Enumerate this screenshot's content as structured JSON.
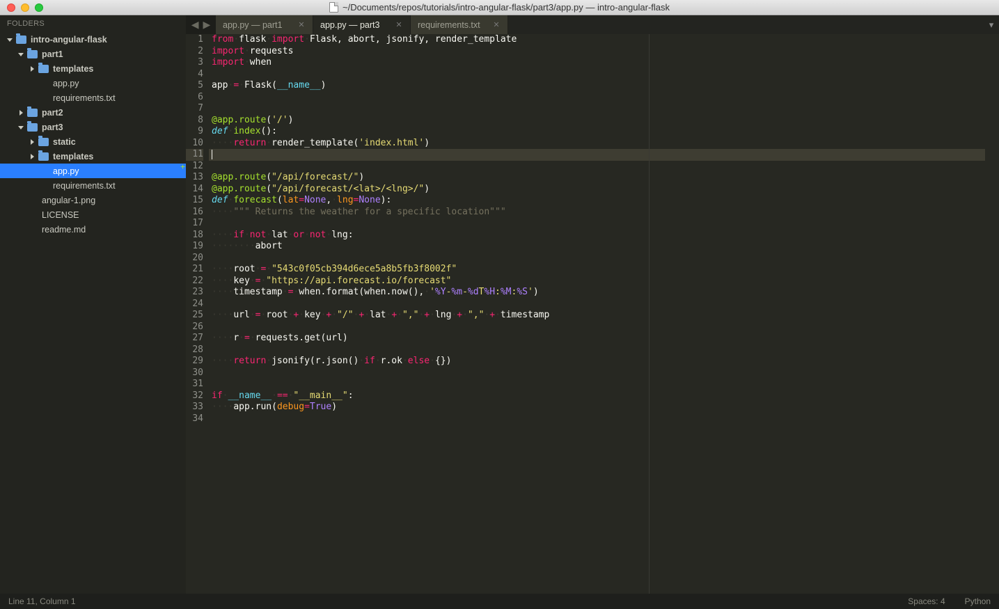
{
  "title": "~/Documents/repos/tutorials/intro-angular-flask/part3/app.py — intro-angular-flask",
  "sidebar": {
    "header": "FOLDERS",
    "nodes": [
      {
        "depth": 0,
        "type": "folder",
        "open": true,
        "label": "intro-angular-flask"
      },
      {
        "depth": 1,
        "type": "folder",
        "open": true,
        "label": "part1"
      },
      {
        "depth": 2,
        "type": "folder",
        "open": false,
        "label": "templates"
      },
      {
        "depth": 2,
        "type": "file",
        "label": "app.py"
      },
      {
        "depth": 2,
        "type": "file",
        "label": "requirements.txt"
      },
      {
        "depth": 1,
        "type": "folder",
        "open": false,
        "label": "part2"
      },
      {
        "depth": 1,
        "type": "folder",
        "open": true,
        "label": "part3"
      },
      {
        "depth": 2,
        "type": "folder",
        "open": false,
        "label": "static"
      },
      {
        "depth": 2,
        "type": "folder",
        "open": false,
        "label": "templates"
      },
      {
        "depth": 2,
        "type": "file",
        "label": "app.py",
        "selected": true
      },
      {
        "depth": 2,
        "type": "file",
        "label": "requirements.txt"
      },
      {
        "depth": 1,
        "type": "file",
        "label": "angular-1.png"
      },
      {
        "depth": 1,
        "type": "file",
        "label": "LICENSE"
      },
      {
        "depth": 1,
        "type": "file",
        "label": "readme.md"
      }
    ]
  },
  "tabs": [
    {
      "label": "app.py — part1",
      "active": false
    },
    {
      "label": "app.py — part3",
      "active": true
    },
    {
      "label": "requirements.txt",
      "active": false
    }
  ],
  "active_line": 11,
  "plus_line": 12,
  "code_lines": [
    [
      {
        "c": "k-red",
        "t": "from"
      },
      {
        "c": "k-dot",
        "t": "·"
      },
      {
        "c": "k-white",
        "t": "flask"
      },
      {
        "c": "k-dot",
        "t": "·"
      },
      {
        "c": "k-red",
        "t": "import"
      },
      {
        "c": "k-dot",
        "t": "·"
      },
      {
        "c": "k-white",
        "t": "Flask, abort, jsonify, render_template"
      }
    ],
    [
      {
        "c": "k-red",
        "t": "import"
      },
      {
        "c": "k-dot",
        "t": "·"
      },
      {
        "c": "k-white",
        "t": "requests"
      }
    ],
    [
      {
        "c": "k-red",
        "t": "import"
      },
      {
        "c": "k-dot",
        "t": "·"
      },
      {
        "c": "k-white",
        "t": "when"
      }
    ],
    [],
    [
      {
        "c": "k-white",
        "t": "app"
      },
      {
        "c": "k-dot",
        "t": "·"
      },
      {
        "c": "k-red",
        "t": "="
      },
      {
        "c": "k-dot",
        "t": "·"
      },
      {
        "c": "k-white",
        "t": "Flask("
      },
      {
        "c": "k-cyan",
        "t": "__name__"
      },
      {
        "c": "k-white",
        "t": ")"
      }
    ],
    [],
    [],
    [
      {
        "c": "k-green",
        "t": "@app.route"
      },
      {
        "c": "k-white",
        "t": "("
      },
      {
        "c": "k-yellow",
        "t": "'/'"
      },
      {
        "c": "k-white",
        "t": ")"
      }
    ],
    [
      {
        "c": "k-def",
        "t": "def"
      },
      {
        "c": "k-dot",
        "t": "·"
      },
      {
        "c": "k-green",
        "t": "index"
      },
      {
        "c": "k-white",
        "t": "():"
      }
    ],
    [
      {
        "c": "k-dot",
        "t": "····"
      },
      {
        "c": "k-red",
        "t": "return"
      },
      {
        "c": "k-dot",
        "t": "·"
      },
      {
        "c": "k-white",
        "t": "render_template("
      },
      {
        "c": "k-yellow",
        "t": "'index.html'"
      },
      {
        "c": "k-white",
        "t": ")"
      }
    ],
    [
      {
        "c": "cursor",
        "t": ""
      }
    ],
    [],
    [
      {
        "c": "k-green",
        "t": "@app.route"
      },
      {
        "c": "k-white",
        "t": "("
      },
      {
        "c": "k-yellow",
        "t": "\"/api/forecast/\""
      },
      {
        "c": "k-white",
        "t": ")"
      }
    ],
    [
      {
        "c": "k-green",
        "t": "@app.route"
      },
      {
        "c": "k-white",
        "t": "("
      },
      {
        "c": "k-yellow",
        "t": "\"/api/forecast/<lat>/<lng>/\""
      },
      {
        "c": "k-white",
        "t": ")"
      }
    ],
    [
      {
        "c": "k-def",
        "t": "def"
      },
      {
        "c": "k-dot",
        "t": "·"
      },
      {
        "c": "k-green",
        "t": "forecast"
      },
      {
        "c": "k-white",
        "t": "("
      },
      {
        "c": "k-orange",
        "t": "lat"
      },
      {
        "c": "k-red",
        "t": "="
      },
      {
        "c": "k-purple",
        "t": "None"
      },
      {
        "c": "k-white",
        "t": ","
      },
      {
        "c": "k-dot",
        "t": "·"
      },
      {
        "c": "k-orange",
        "t": "lng"
      },
      {
        "c": "k-red",
        "t": "="
      },
      {
        "c": "k-purple",
        "t": "None"
      },
      {
        "c": "k-white",
        "t": "):"
      }
    ],
    [
      {
        "c": "k-dot",
        "t": "····"
      },
      {
        "c": "k-comment",
        "t": "\"\"\" Returns the weather for a specific location\"\"\""
      }
    ],
    [],
    [
      {
        "c": "k-dot",
        "t": "····"
      },
      {
        "c": "k-red",
        "t": "if"
      },
      {
        "c": "k-dot",
        "t": "·"
      },
      {
        "c": "k-red",
        "t": "not"
      },
      {
        "c": "k-dot",
        "t": "·"
      },
      {
        "c": "k-white",
        "t": "lat"
      },
      {
        "c": "k-dot",
        "t": "·"
      },
      {
        "c": "k-red",
        "t": "or"
      },
      {
        "c": "k-dot",
        "t": "·"
      },
      {
        "c": "k-red",
        "t": "not"
      },
      {
        "c": "k-dot",
        "t": "·"
      },
      {
        "c": "k-white",
        "t": "lng:"
      }
    ],
    [
      {
        "c": "k-dot",
        "t": "········"
      },
      {
        "c": "k-white",
        "t": "abort"
      }
    ],
    [],
    [
      {
        "c": "k-dot",
        "t": "····"
      },
      {
        "c": "k-white",
        "t": "root"
      },
      {
        "c": "k-dot",
        "t": "·"
      },
      {
        "c": "k-red",
        "t": "="
      },
      {
        "c": "k-dot",
        "t": "·"
      },
      {
        "c": "k-yellow",
        "t": "\"543c0f05cb394d6ece5a8b5fb3f8002f\""
      }
    ],
    [
      {
        "c": "k-dot",
        "t": "····"
      },
      {
        "c": "k-white",
        "t": "key"
      },
      {
        "c": "k-dot",
        "t": "·"
      },
      {
        "c": "k-red",
        "t": "="
      },
      {
        "c": "k-dot",
        "t": "·"
      },
      {
        "c": "k-yellow",
        "t": "\"https://api.forecast.io/forecast\""
      }
    ],
    [
      {
        "c": "k-dot",
        "t": "····"
      },
      {
        "c": "k-white",
        "t": "timestamp"
      },
      {
        "c": "k-dot",
        "t": "·"
      },
      {
        "c": "k-red",
        "t": "="
      },
      {
        "c": "k-dot",
        "t": "·"
      },
      {
        "c": "k-white",
        "t": "when.format(when.now(),"
      },
      {
        "c": "k-dot",
        "t": "·"
      },
      {
        "c": "k-yellow",
        "t": "'"
      },
      {
        "c": "k-purple",
        "t": "%Y"
      },
      {
        "c": "k-yellow",
        "t": "-"
      },
      {
        "c": "k-purple",
        "t": "%m"
      },
      {
        "c": "k-yellow",
        "t": "-"
      },
      {
        "c": "k-purple",
        "t": "%d"
      },
      {
        "c": "k-yellow",
        "t": "T"
      },
      {
        "c": "k-purple",
        "t": "%H"
      },
      {
        "c": "k-yellow",
        "t": ":"
      },
      {
        "c": "k-purple",
        "t": "%M"
      },
      {
        "c": "k-yellow",
        "t": ":"
      },
      {
        "c": "k-purple",
        "t": "%S"
      },
      {
        "c": "k-yellow",
        "t": "'"
      },
      {
        "c": "k-white",
        "t": ")"
      }
    ],
    [],
    [
      {
        "c": "k-dot",
        "t": "····"
      },
      {
        "c": "k-white",
        "t": "url"
      },
      {
        "c": "k-dot",
        "t": "·"
      },
      {
        "c": "k-red",
        "t": "="
      },
      {
        "c": "k-dot",
        "t": "·"
      },
      {
        "c": "k-white",
        "t": "root"
      },
      {
        "c": "k-dot",
        "t": "·"
      },
      {
        "c": "k-red",
        "t": "+"
      },
      {
        "c": "k-dot",
        "t": "·"
      },
      {
        "c": "k-white",
        "t": "key"
      },
      {
        "c": "k-dot",
        "t": "·"
      },
      {
        "c": "k-red",
        "t": "+"
      },
      {
        "c": "k-dot",
        "t": "·"
      },
      {
        "c": "k-yellow",
        "t": "\"/\""
      },
      {
        "c": "k-dot",
        "t": "·"
      },
      {
        "c": "k-red",
        "t": "+"
      },
      {
        "c": "k-dot",
        "t": "·"
      },
      {
        "c": "k-white",
        "t": "lat"
      },
      {
        "c": "k-dot",
        "t": "·"
      },
      {
        "c": "k-red",
        "t": "+"
      },
      {
        "c": "k-dot",
        "t": "·"
      },
      {
        "c": "k-yellow",
        "t": "\",\""
      },
      {
        "c": "k-dot",
        "t": "·"
      },
      {
        "c": "k-red",
        "t": "+"
      },
      {
        "c": "k-dot",
        "t": "·"
      },
      {
        "c": "k-white",
        "t": "lng"
      },
      {
        "c": "k-dot",
        "t": "·"
      },
      {
        "c": "k-red",
        "t": "+"
      },
      {
        "c": "k-dot",
        "t": "·"
      },
      {
        "c": "k-yellow",
        "t": "\",\""
      },
      {
        "c": "k-dot",
        "t": "·"
      },
      {
        "c": "k-red",
        "t": "+"
      },
      {
        "c": "k-dot",
        "t": "·"
      },
      {
        "c": "k-white",
        "t": "timestamp"
      }
    ],
    [],
    [
      {
        "c": "k-dot",
        "t": "····"
      },
      {
        "c": "k-white",
        "t": "r"
      },
      {
        "c": "k-dot",
        "t": "·"
      },
      {
        "c": "k-red",
        "t": "="
      },
      {
        "c": "k-dot",
        "t": "·"
      },
      {
        "c": "k-white",
        "t": "requests.get(url)"
      }
    ],
    [],
    [
      {
        "c": "k-dot",
        "t": "····"
      },
      {
        "c": "k-red",
        "t": "return"
      },
      {
        "c": "k-dot",
        "t": "·"
      },
      {
        "c": "k-white",
        "t": "jsonify(r.json()"
      },
      {
        "c": "k-dot",
        "t": "·"
      },
      {
        "c": "k-red",
        "t": "if"
      },
      {
        "c": "k-dot",
        "t": "·"
      },
      {
        "c": "k-white",
        "t": "r.ok"
      },
      {
        "c": "k-dot",
        "t": "·"
      },
      {
        "c": "k-red",
        "t": "else"
      },
      {
        "c": "k-dot",
        "t": "·"
      },
      {
        "c": "k-white",
        "t": "{})"
      }
    ],
    [],
    [],
    [
      {
        "c": "k-red",
        "t": "if"
      },
      {
        "c": "k-dot",
        "t": "·"
      },
      {
        "c": "k-cyan",
        "t": "__name__"
      },
      {
        "c": "k-dot",
        "t": "·"
      },
      {
        "c": "k-red",
        "t": "=="
      },
      {
        "c": "k-dot",
        "t": "·"
      },
      {
        "c": "k-yellow",
        "t": "\"__main__\""
      },
      {
        "c": "k-white",
        "t": ":"
      }
    ],
    [
      {
        "c": "k-dot",
        "t": "····"
      },
      {
        "c": "k-white",
        "t": "app.run("
      },
      {
        "c": "k-orange",
        "t": "debug"
      },
      {
        "c": "k-red",
        "t": "="
      },
      {
        "c": "k-purple",
        "t": "True"
      },
      {
        "c": "k-white",
        "t": ")"
      }
    ],
    []
  ],
  "status": {
    "position": "Line 11, Column 1",
    "spaces": "Spaces: 4",
    "language": "Python"
  }
}
